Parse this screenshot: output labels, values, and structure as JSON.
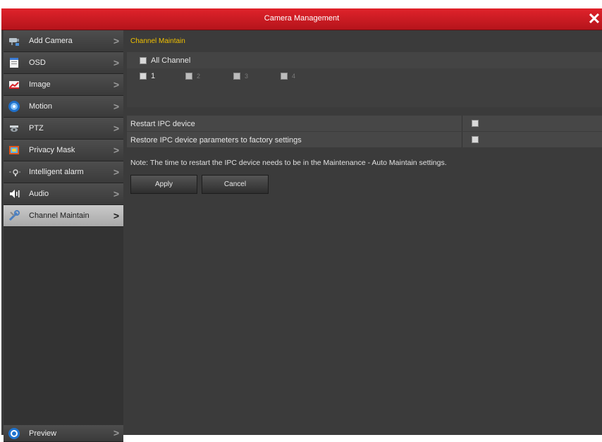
{
  "window": {
    "title": "Camera Management"
  },
  "sidebar": {
    "items": [
      {
        "label": "Add Camera"
      },
      {
        "label": "OSD"
      },
      {
        "label": "Image"
      },
      {
        "label": "Motion"
      },
      {
        "label": "PTZ"
      },
      {
        "label": "Privacy Mask"
      },
      {
        "label": "Intelligent alarm"
      },
      {
        "label": "Audio"
      },
      {
        "label": "Channel Maintain",
        "active": true
      }
    ],
    "bottom": {
      "label": "Preview"
    }
  },
  "main": {
    "section_title": "Channel Maintain",
    "all_channel_label": "All Channel",
    "channels": [
      "1",
      "2",
      "3",
      "4"
    ],
    "restart_label": "Restart IPC device",
    "factory_label": "Restore IPC device parameters to factory settings",
    "note": "Note: The time to restart the IPC device needs to be in the Maintenance - Auto Maintain settings.",
    "apply_label": "Apply",
    "cancel_label": "Cancel"
  },
  "colors": {
    "title_bar": "#d01c24",
    "section_title": "#f0c000",
    "panel_bg": "#3b3b3b"
  }
}
